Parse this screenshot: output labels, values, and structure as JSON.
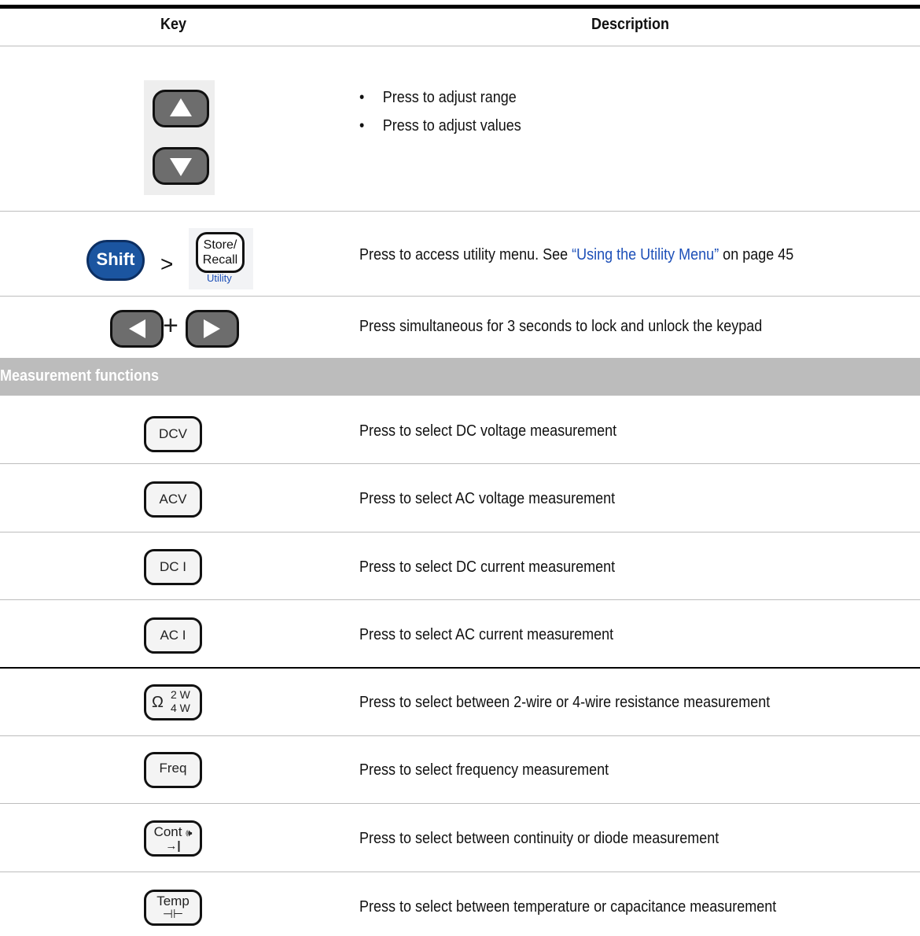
{
  "header": {
    "key": "Key",
    "description": "Description"
  },
  "rows": [
    {
      "keys": [
        "up-arrow",
        "down-arrow"
      ],
      "bullets": [
        "Press to adjust range",
        "Press to adjust values"
      ]
    },
    {
      "key_labels": {
        "shift": "Shift",
        "separator": ">",
        "store_line1": "Store/",
        "store_line2": "Recall",
        "utility": "Utility"
      },
      "text_before": "Press to access utility menu. See ",
      "link_text": "“Using the Utility Menu”",
      "text_after": " on page 45"
    },
    {
      "keys": [
        "left-arrow",
        "right-arrow"
      ],
      "separator": "+",
      "text": "Press simultaneous for 3 seconds to lock and unlock the keypad"
    }
  ],
  "section": {
    "title": "Measurement functions"
  },
  "functions": [
    {
      "key_label": "DCV",
      "text": "Press to select DC voltage measurement"
    },
    {
      "key_label": "ACV",
      "text": "Press to select AC voltage measurement"
    },
    {
      "key_label": "DC I",
      "text": "Press to select DC current measurement"
    },
    {
      "key_label": "AC I",
      "text": "Press to select AC current measurement"
    },
    {
      "key_label": "Ω",
      "key_sub_top": "2 W",
      "key_sub_bottom": "4 W",
      "text": "Press to select between 2-wire or 4-wire resistance measurement"
    },
    {
      "key_label": "Freq",
      "text": "Press to select frequency measurement"
    },
    {
      "key_label": "Cont",
      "key_sub_bottom": "→|",
      "text": "Press to select between continuity or diode measurement"
    },
    {
      "key_label": "Temp",
      "key_sub_bottom": "⊣⊢",
      "text": "Press to select between temperature or capacitance measurement"
    }
  ],
  "colors": {
    "section_bg": "#bcbcbc",
    "link": "#1c4fb8",
    "shift_key": "#1b55a0",
    "arrow_key": "#6d6d6d"
  }
}
